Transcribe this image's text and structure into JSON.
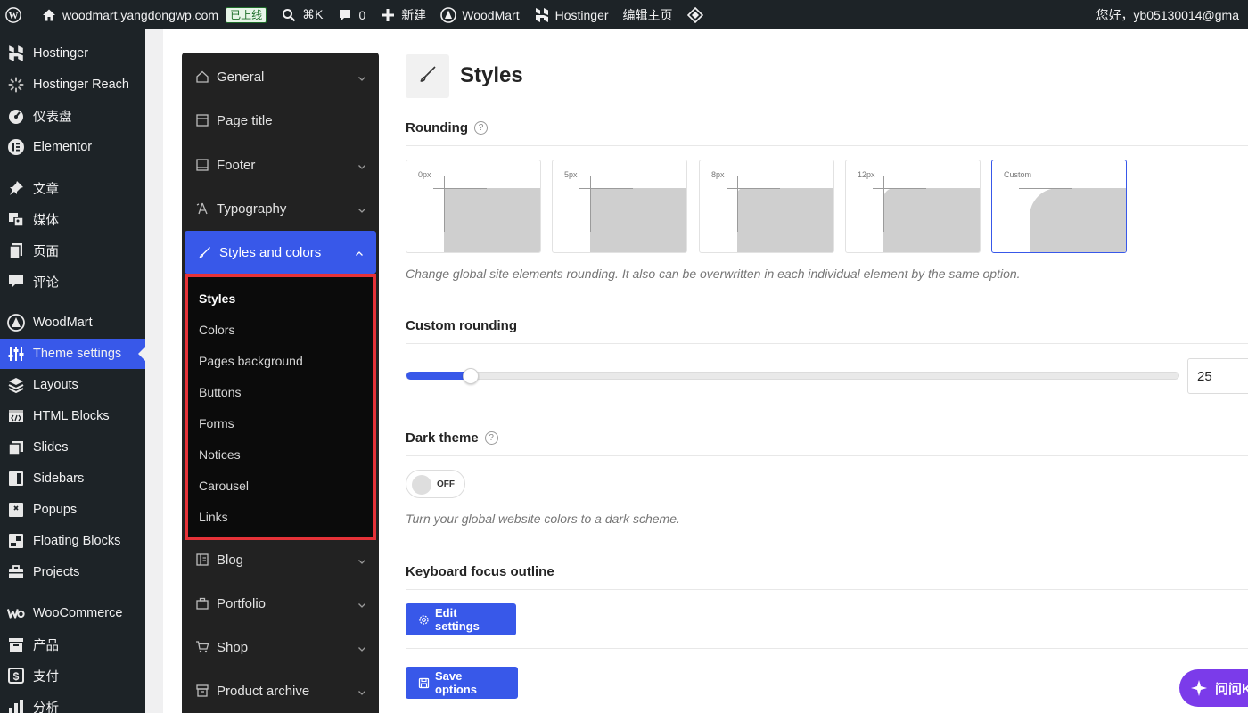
{
  "adminbar": {
    "site_name": "woodmart.yangdongwp.com",
    "status_badge": "已上线",
    "search_shortcut": "⌘K",
    "comments_count": "0",
    "new_label": "新建",
    "woodmart_label": "WoodMart",
    "hostinger_label": "Hostinger",
    "edit_home_label": "编辑主页",
    "greeting": "您好，yb05130014@gma"
  },
  "wp_menu": {
    "items": [
      {
        "label": "Hostinger",
        "icon": "hostinger-icon"
      },
      {
        "label": "Hostinger Reach",
        "icon": "spinner-icon"
      },
      {
        "label": "仪表盘",
        "icon": "dashboard-icon"
      },
      {
        "label": "Elementor",
        "icon": "elementor-icon"
      },
      {
        "label": "文章",
        "icon": "pin-icon"
      },
      {
        "label": "媒体",
        "icon": "media-icon"
      },
      {
        "label": "页面",
        "icon": "page-icon"
      },
      {
        "label": "评论",
        "icon": "comment-icon"
      },
      {
        "label": "WoodMart",
        "icon": "woodmart-icon"
      },
      {
        "label": "Theme settings",
        "icon": "sliders-icon"
      },
      {
        "label": "Layouts",
        "icon": "layers-icon"
      },
      {
        "label": "HTML Blocks",
        "icon": "code-block-icon"
      },
      {
        "label": "Slides",
        "icon": "slides-icon"
      },
      {
        "label": "Sidebars",
        "icon": "sidebar-icon"
      },
      {
        "label": "Popups",
        "icon": "popup-icon"
      },
      {
        "label": "Floating Blocks",
        "icon": "floating-block-icon"
      },
      {
        "label": "Projects",
        "icon": "briefcase-icon"
      },
      {
        "label": "WooCommerce",
        "icon": "woo-icon"
      },
      {
        "label": "产品",
        "icon": "archive-icon"
      },
      {
        "label": "支付",
        "icon": "dollar-icon"
      },
      {
        "label": "分析",
        "icon": "bar-chart-icon"
      }
    ],
    "active": "Theme settings"
  },
  "theme_nav": {
    "items": [
      {
        "label": "General",
        "icon": "home-icon",
        "chevron": "down"
      },
      {
        "label": "Page title",
        "icon": "window-icon",
        "chevron": ""
      },
      {
        "label": "Footer",
        "icon": "footer-icon",
        "chevron": "down"
      },
      {
        "label": "Typography",
        "icon": "typography-icon",
        "chevron": "down"
      },
      {
        "label": "Styles and colors",
        "icon": "brush-icon",
        "chevron": "up"
      },
      {
        "label": "Blog",
        "icon": "blog-icon",
        "chevron": "down"
      },
      {
        "label": "Portfolio",
        "icon": "portfolio-icon",
        "chevron": "down"
      },
      {
        "label": "Shop",
        "icon": "cart-icon",
        "chevron": "down"
      },
      {
        "label": "Product archive",
        "icon": "product-archive-icon",
        "chevron": "down"
      }
    ],
    "submenu": [
      "Styles",
      "Colors",
      "Pages background",
      "Buttons",
      "Forms",
      "Notices",
      "Carousel",
      "Links"
    ],
    "submenu_current": "Styles",
    "highlight_color": "#e53238",
    "accent_color": "#3858e9"
  },
  "main": {
    "title": "Styles",
    "rounding": {
      "title": "Rounding",
      "options": [
        "0px",
        "5px",
        "8px",
        "12px",
        "Custom"
      ],
      "selected": "Custom",
      "hint": "Change global site elements rounding. It also can be overwritten in each individual element by the same option."
    },
    "custom_rounding": {
      "title": "Custom rounding",
      "value": "25",
      "slider_fraction": 0.083
    },
    "dark_theme": {
      "title": "Dark theme",
      "toggle_state": "OFF",
      "hint": "Turn your global website colors to a dark scheme."
    },
    "keyboard_focus": {
      "title": "Keyboard focus outline",
      "button_label": "Edit settings"
    },
    "save_label": "Save options",
    "chat_label": "问问K"
  }
}
